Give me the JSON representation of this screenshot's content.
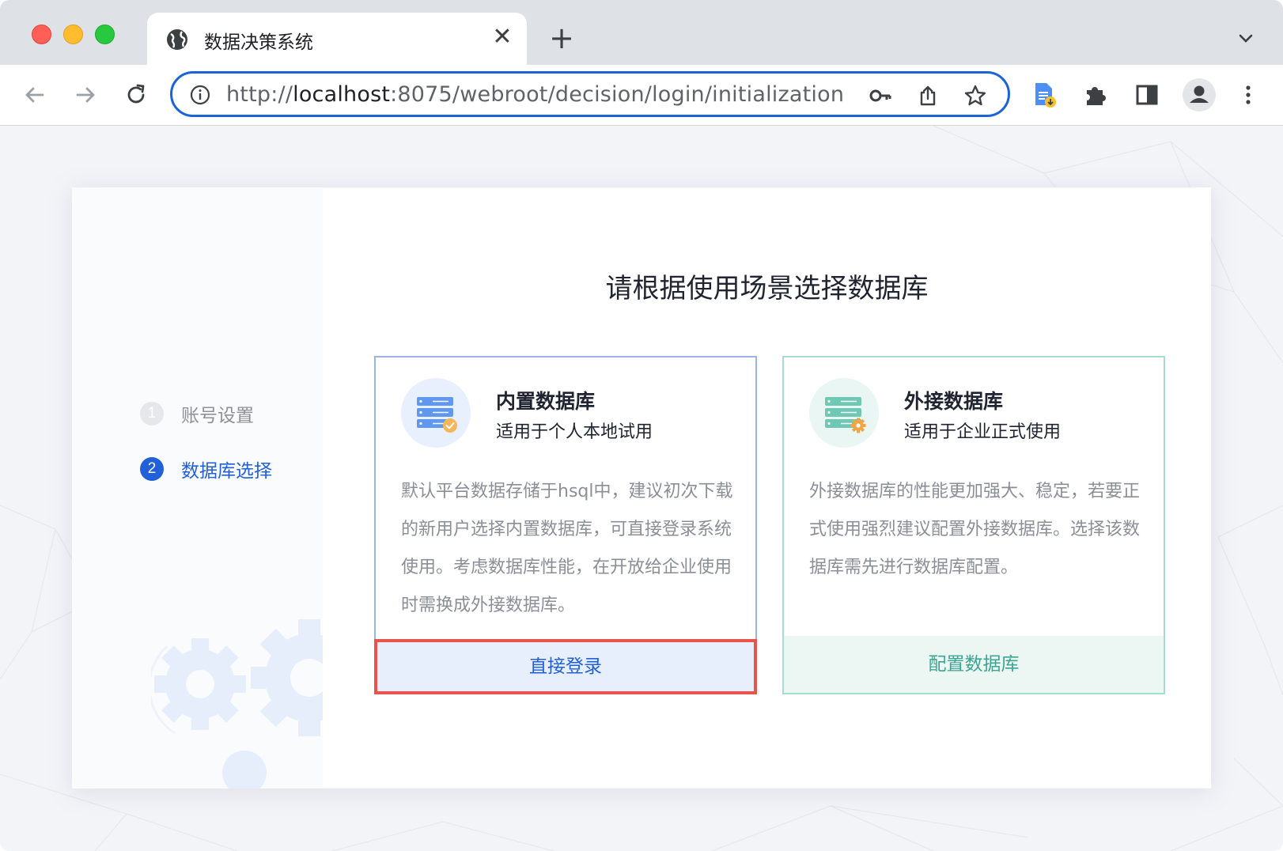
{
  "browser": {
    "tab_title": "数据决策系统",
    "tab_close_icon": "close-icon",
    "new_tab_icon": "plus-icon",
    "url_prefix": "http://",
    "url_host": "localhost",
    "url_rest": ":8075/webroot/decision/login/initialization",
    "accent": "#1a63d8"
  },
  "sidebar": {
    "steps": [
      {
        "number": "1",
        "label": "账号设置",
        "state": "done"
      },
      {
        "number": "2",
        "label": "数据库选择",
        "state": "active"
      }
    ]
  },
  "main": {
    "heading": "请根据使用场景选择数据库",
    "options": [
      {
        "title": "内置数据库",
        "subtitle": "适用于个人本地试用",
        "description": "默认平台数据存储于hsql中，建议初次下载的新用户选择内置数据库，可直接登录系统使用。考虑数据库性能，在开放给企业使用时需换成外接数据库。",
        "button": "直接登录",
        "color": "#2160d9"
      },
      {
        "title": "外接数据库",
        "subtitle": "适用于企业正式使用",
        "description": "外接数据库的性能更加强大、稳定，若要正式使用强烈建议配置外接数据库。选择该数据库需先进行数据库配置。",
        "button": "配置数据库",
        "color": "#3aa591"
      }
    ]
  }
}
